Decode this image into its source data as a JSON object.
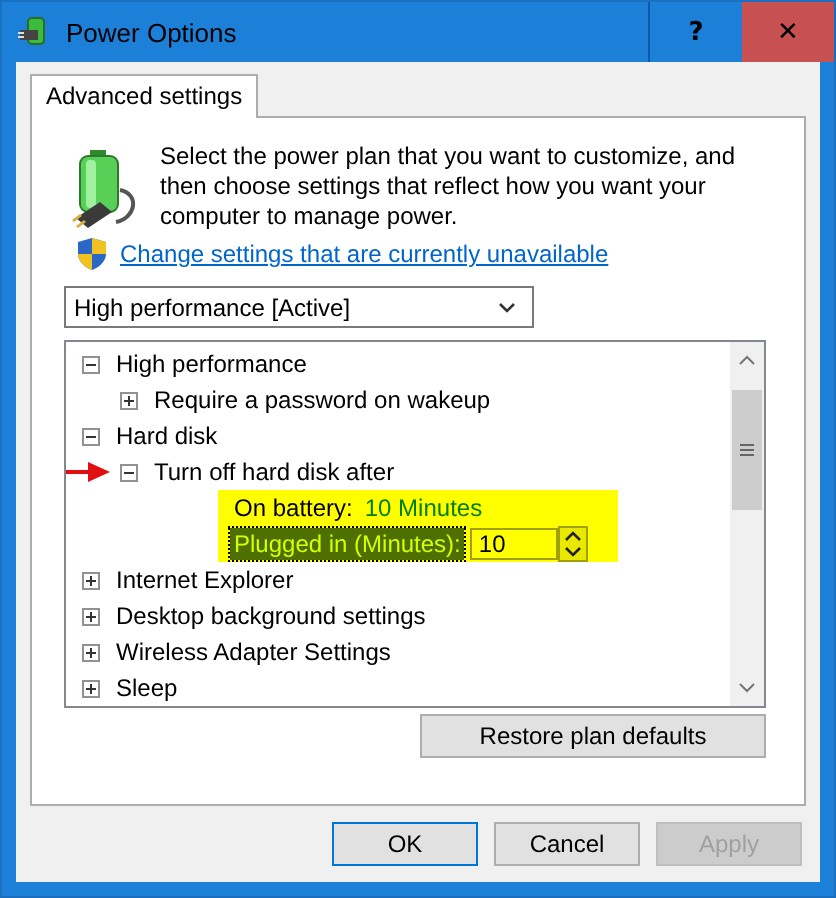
{
  "window": {
    "title": "Power Options",
    "help": "?",
    "close": "✕"
  },
  "tabs": [
    {
      "label": "Advanced settings",
      "selected": true
    }
  ],
  "description": "Select the power plan that you want to customize, and then choose settings that reflect how you want your computer to manage power.",
  "link": "Change settings that are currently unavailable",
  "plan_dropdown": {
    "value": "High performance [Active]"
  },
  "tree": [
    {
      "kind": "group",
      "label": "High performance",
      "expanded": true,
      "children": [
        {
          "kind": "group",
          "label": "Require a password on wakeup",
          "expanded": false
        }
      ]
    },
    {
      "kind": "group",
      "label": "Hard disk",
      "expanded": true,
      "children": [
        {
          "kind": "group",
          "label": "Turn off hard disk after",
          "expanded": true,
          "pointer": true,
          "children": [
            {
              "kind": "value",
              "label": "On battery:",
              "value": "10 Minutes",
              "highlighted": true
            },
            {
              "kind": "spin",
              "label": "Plugged in (Minutes):",
              "value": "10",
              "highlighted": true,
              "selected": true
            }
          ]
        }
      ]
    },
    {
      "kind": "group",
      "label": "Internet Explorer",
      "expanded": false
    },
    {
      "kind": "group",
      "label": "Desktop background settings",
      "expanded": false
    },
    {
      "kind": "group",
      "label": "Wireless Adapter Settings",
      "expanded": false
    },
    {
      "kind": "group",
      "label": "Sleep",
      "expanded": false
    }
  ],
  "restore_button": "Restore plan defaults",
  "buttons": [
    {
      "label": "OK",
      "disabled": false
    },
    {
      "label": "Cancel",
      "disabled": false
    },
    {
      "label": "Apply",
      "disabled": true
    }
  ]
}
